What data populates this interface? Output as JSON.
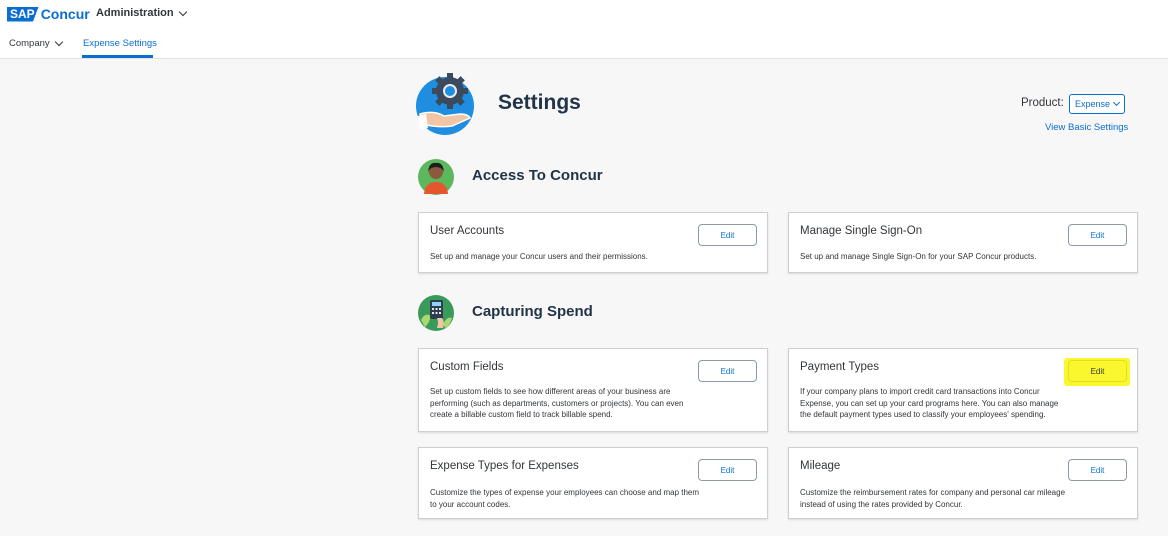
{
  "header": {
    "logo_sap": "SAP",
    "logo_concur": "Concur",
    "admin_menu_label": "Administration",
    "nav": {
      "company_label": "Company",
      "expense_settings_label": "Expense Settings"
    }
  },
  "settings": {
    "title": "Settings",
    "product_label": "Product:",
    "product_value": "Expense",
    "view_basic_link": "View Basic Settings"
  },
  "sections": {
    "access": {
      "title": "Access To Concur",
      "cards": [
        {
          "title": "User Accounts",
          "description": "Set up and manage your Concur users and their permissions.",
          "button": "Edit"
        },
        {
          "title": "Manage Single Sign-On",
          "description": "Set up and manage Single Sign-On for your SAP Concur products.",
          "button": "Edit"
        }
      ]
    },
    "spend": {
      "title": "Capturing Spend",
      "cards": [
        {
          "title": "Custom Fields",
          "description": "Set up custom fields to see how different areas of your business are performing (such as departments, customers or projects). You can even create a billable custom field to track billable spend.",
          "button": "Edit"
        },
        {
          "title": "Payment Types",
          "description": "If your company plans to import credit card transactions into Concur Expense, you can set up your card programs here. You can also manage the default payment types used to classify your employees' spending.",
          "button": "Edit"
        },
        {
          "title": "Expense Types for Expenses",
          "description": "Customize the types of expense your employees can choose and map them to your account codes.",
          "button": "Edit"
        },
        {
          "title": "Mileage",
          "description": "Customize the reimbursement rates for company and personal car mileage instead of using the rates provided by Concur.",
          "button": "Edit"
        }
      ]
    }
  },
  "colors": {
    "brand_blue": "#0a6ed1",
    "highlight_yellow": "#fbf72f",
    "title_navy": "#223548"
  },
  "icons": [
    "chevron-down-icon",
    "settings-gear-hand-icon",
    "person-avatar-icon",
    "spend-receipt-icon"
  ]
}
